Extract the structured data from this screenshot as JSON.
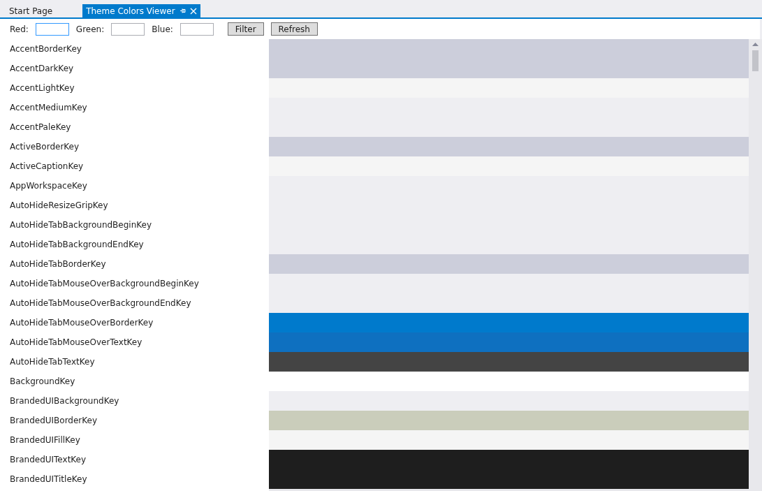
{
  "tabs": [
    {
      "label": "Start Page",
      "selected": false
    },
    {
      "label": "Theme Colors Viewer",
      "selected": true
    }
  ],
  "filters": [
    {
      "label": "Red:",
      "focused": true
    },
    {
      "label": "Green:",
      "focused": false
    },
    {
      "label": "Blue:",
      "focused": false
    }
  ],
  "buttons": [
    "Filter",
    "Refresh"
  ],
  "rows": [
    {
      "name": "AccentBorderKey",
      "color": "#cccedb"
    },
    {
      "name": "AccentDarkKey",
      "color": "#cccedb"
    },
    {
      "name": "AccentLightKey",
      "color": "#f5f5f5"
    },
    {
      "name": "AccentMediumKey",
      "color": "#eeeef2"
    },
    {
      "name": "AccentPaleKey",
      "color": "#eeeef2"
    },
    {
      "name": "ActiveBorderKey",
      "color": "#cccedb"
    },
    {
      "name": "ActiveCaptionKey",
      "color": "#f5f5f5"
    },
    {
      "name": "AppWorkspaceKey",
      "color": "#eeeef2"
    },
    {
      "name": "AutoHideResizeGripKey",
      "color": "#eeeef2"
    },
    {
      "name": "AutoHideTabBackgroundBeginKey",
      "color": "#eeeef2"
    },
    {
      "name": "AutoHideTabBackgroundEndKey",
      "color": "#eeeef2"
    },
    {
      "name": "AutoHideTabBorderKey",
      "color": "#cccedb"
    },
    {
      "name": "AutoHideTabMouseOverBackgroundBeginKey",
      "color": "#eeeef2"
    },
    {
      "name": "AutoHideTabMouseOverBackgroundEndKey",
      "color": "#eeeef2"
    },
    {
      "name": "AutoHideTabMouseOverBorderKey",
      "color": "#007acc"
    },
    {
      "name": "AutoHideTabMouseOverTextKey",
      "color": "#0e70c0"
    },
    {
      "name": "AutoHideTabTextKey",
      "color": "#444444"
    },
    {
      "name": "BackgroundKey",
      "color": "#ffffff"
    },
    {
      "name": "BrandedUIBackgroundKey",
      "color": "#eeeef2"
    },
    {
      "name": "BrandedUIBorderKey",
      "color": "#cacdbb"
    },
    {
      "name": "BrandedUIFillKey",
      "color": "#f5f5f5"
    },
    {
      "name": "BrandedUITextKey",
      "color": "#1e1e1e"
    },
    {
      "name": "BrandedUITitleKey",
      "color": "#1e1e1e"
    }
  ]
}
